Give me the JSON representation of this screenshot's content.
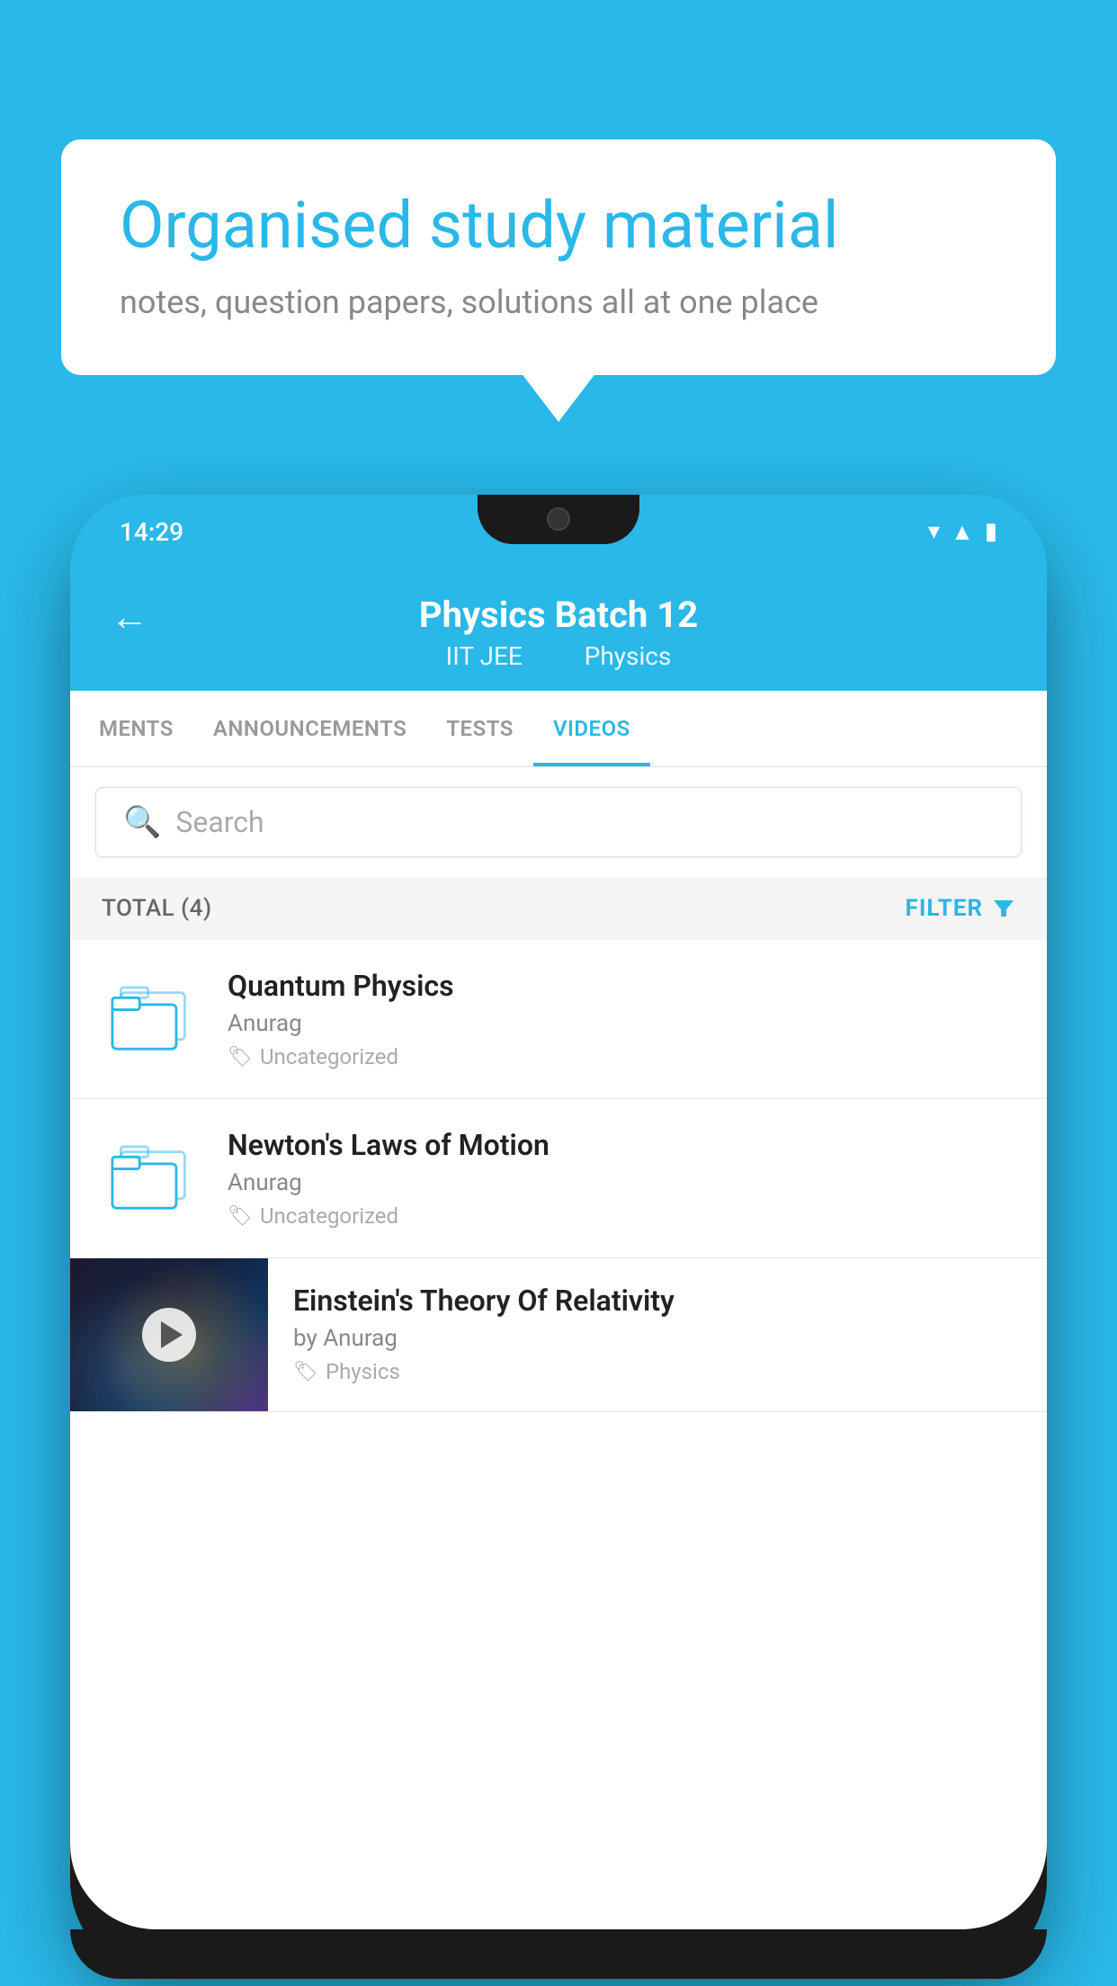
{
  "background_color": "#29b8e8",
  "speech_bubble": {
    "title": "Organised study material",
    "subtitle": "notes, question papers, solutions all at one place"
  },
  "phone": {
    "status_bar": {
      "time": "14:29",
      "wifi_icon": "wifi",
      "signal_icon": "signal",
      "battery_icon": "battery"
    },
    "header": {
      "back_label": "←",
      "title": "Physics Batch 12",
      "subtitle_part1": "IIT JEE",
      "subtitle_part2": "Physics"
    },
    "tabs": [
      {
        "label": "MENTS",
        "active": false
      },
      {
        "label": "ANNOUNCEMENTS",
        "active": false
      },
      {
        "label": "TESTS",
        "active": false
      },
      {
        "label": "VIDEOS",
        "active": true
      }
    ],
    "search": {
      "placeholder": "Search"
    },
    "filter_bar": {
      "total_label": "TOTAL (4)",
      "filter_label": "FILTER"
    },
    "videos": [
      {
        "id": 1,
        "title": "Quantum Physics",
        "author": "Anurag",
        "tag": "Uncategorized",
        "has_thumb": false
      },
      {
        "id": 2,
        "title": "Newton's Laws of Motion",
        "author": "Anurag",
        "tag": "Uncategorized",
        "has_thumb": false
      },
      {
        "id": 3,
        "title": "Einstein's Theory Of Relativity",
        "author": "by Anurag",
        "tag": "Physics",
        "has_thumb": true
      }
    ]
  }
}
